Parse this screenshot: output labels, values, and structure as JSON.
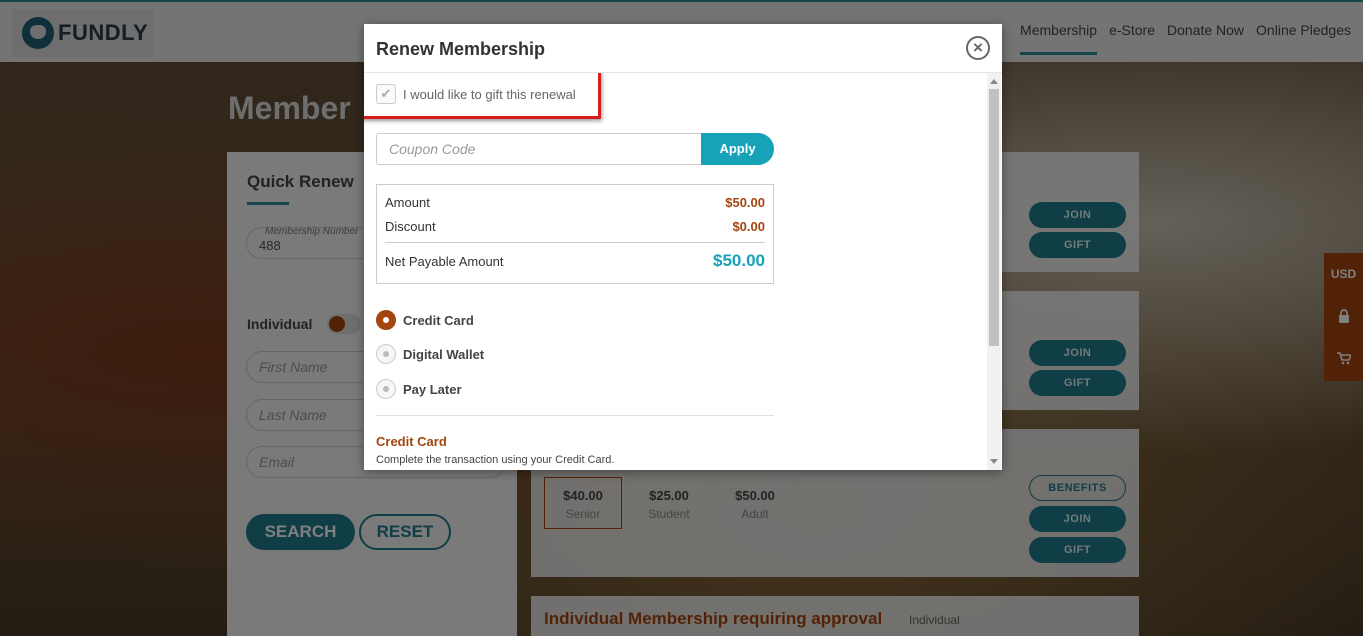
{
  "brand": {
    "name": "FUNDLY"
  },
  "nav": {
    "items": [
      "Membership",
      "e-Store",
      "Donate Now",
      "Online Pledges"
    ]
  },
  "page": {
    "title": "Member"
  },
  "quick_renew": {
    "title": "Quick Renew",
    "membership_number_label": "Membership Number",
    "membership_number_value": "488",
    "individual_label": "Individual",
    "first_name_placeholder": "First Name",
    "last_name_placeholder": "Last Name",
    "email_placeholder": "Email",
    "search_label": "SEARCH",
    "reset_label": "RESET"
  },
  "cards": {
    "join_label": "JOIN",
    "gift_label": "GIFT",
    "benefits_label": "BENEFITS",
    "prices": [
      {
        "amount": "$40.00",
        "tier": "Senior"
      },
      {
        "amount": "$25.00",
        "tier": "Student"
      },
      {
        "amount": "$50.00",
        "tier": "Adult"
      }
    ],
    "approval_title": "Individual Membership requiring approval",
    "approval_sub": "Individual"
  },
  "side_tab": {
    "currency": "USD"
  },
  "modal": {
    "title": "Renew Membership",
    "gift_checkbox_label": "I would like to gift this renewal",
    "coupon_placeholder": "Coupon Code",
    "apply_label": "Apply",
    "summary": {
      "amount_label": "Amount",
      "amount_value": "$50.00",
      "discount_label": "Discount",
      "discount_value": "$0.00",
      "net_label": "Net Payable Amount",
      "net_value": "$50.00"
    },
    "payment_methods": [
      "Credit Card",
      "Digital Wallet",
      "Pay Later"
    ],
    "selected_payment": "Credit Card",
    "credit_card_title": "Credit Card",
    "credit_card_desc": "Complete the transaction using your Credit Card."
  },
  "colors": {
    "accent": "#a4450f",
    "teal": "#17a2b8",
    "highlight": "#d81d1d"
  }
}
